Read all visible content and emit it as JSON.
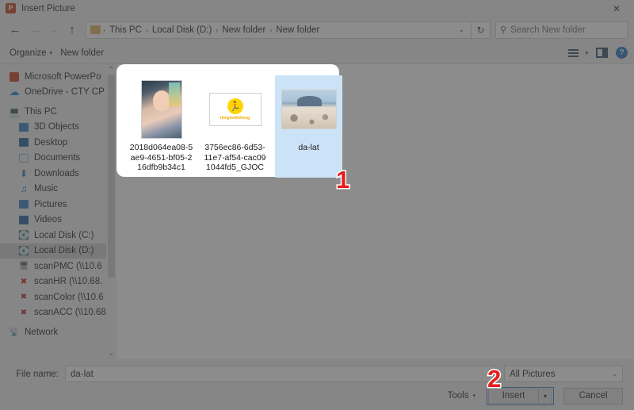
{
  "window": {
    "title": "Insert Picture",
    "app_icon": "powerpoint-icon",
    "close_label": "✕",
    "accent_color": "#c43e1c"
  },
  "nav": {
    "back": "←",
    "forward": "→",
    "recent": "⌄",
    "up": "↑",
    "refresh": "↻",
    "dropdown_caret": "⌄",
    "breadcrumbs": [
      "This PC",
      "Local Disk (D:)",
      "New folder",
      "New folder"
    ],
    "separator": "›"
  },
  "search": {
    "placeholder": "Search New folder",
    "icon": "search-icon"
  },
  "commandbar": {
    "organize": "Organize",
    "new_folder": "New folder",
    "caret": "▾",
    "view_icon": "view-options-icon",
    "pane_icon": "preview-pane-icon",
    "help_icon": "help-icon",
    "help_glyph": "?"
  },
  "sidebar": {
    "items": [
      {
        "label": "Microsoft PowerPo",
        "icon": "powerpoint-icon",
        "level": 0,
        "selected": false
      },
      {
        "label": "OneDrive - CTY CP",
        "icon": "onedrive-icon",
        "level": 0,
        "selected": false
      },
      {
        "label": "This PC",
        "icon": "this-pc-icon",
        "level": 0,
        "selected": false
      },
      {
        "label": "3D Objects",
        "icon": "3d-objects-icon",
        "level": 1,
        "selected": false
      },
      {
        "label": "Desktop",
        "icon": "desktop-icon",
        "level": 1,
        "selected": false
      },
      {
        "label": "Documents",
        "icon": "documents-icon",
        "level": 1,
        "selected": false
      },
      {
        "label": "Downloads",
        "icon": "downloads-icon",
        "level": 1,
        "selected": false
      },
      {
        "label": "Music",
        "icon": "music-icon",
        "level": 1,
        "selected": false
      },
      {
        "label": "Pictures",
        "icon": "pictures-icon",
        "level": 1,
        "selected": false
      },
      {
        "label": "Videos",
        "icon": "videos-icon",
        "level": 1,
        "selected": false
      },
      {
        "label": "Local Disk (C:)",
        "icon": "drive-icon",
        "level": 1,
        "selected": false
      },
      {
        "label": "Local Disk (D:)",
        "icon": "drive-icon",
        "level": 1,
        "selected": true
      },
      {
        "label": "scanPMC (\\\\10.6",
        "icon": "network-drive-icon",
        "level": 1,
        "selected": false
      },
      {
        "label": "scanHR (\\\\10.68.",
        "icon": "network-drive-disconnected-icon",
        "level": 1,
        "selected": false
      },
      {
        "label": "scanColor (\\\\10.6",
        "icon": "network-drive-disconnected-icon",
        "level": 1,
        "selected": false
      },
      {
        "label": "scanACC (\\\\10.68",
        "icon": "network-drive-disconnected-icon",
        "level": 1,
        "selected": false
      },
      {
        "label": "Network",
        "icon": "network-icon",
        "level": 0,
        "selected": false
      }
    ],
    "scroll_up": "⌃",
    "scroll_down": "⌄"
  },
  "files": [
    {
      "name": "2018d064ea08-5ae9-4651-bf05-216dfb9b34c1",
      "thumb": "portrait-photo-thumbnail",
      "selected": false
    },
    {
      "name": "3756ec86-6d53-11e7-af54-cac091044fd5_GJOC",
      "thumb": "yellow-logo-thumbnail",
      "logo_text": "thegioididong",
      "logo_glyph": "☃",
      "selected": false
    },
    {
      "name": "da-lat",
      "thumb": "landscape-photo-thumbnail",
      "selected": true
    }
  ],
  "footer": {
    "file_name_label": "File name:",
    "file_name_value": "da-lat",
    "filter_value": "All Pictures",
    "filter_caret": "⌄",
    "tools_label": "Tools",
    "tools_caret": "▾",
    "insert_label": "Insert",
    "insert_caret": "▾",
    "cancel_label": "Cancel"
  },
  "annotations": [
    {
      "label": "1",
      "target": "file-list-panel"
    },
    {
      "label": "2",
      "target": "insert-button"
    }
  ],
  "colors": {
    "selection_blue": "#cce3f7",
    "focus_border": "#2a72c4",
    "marker_red": "#e81b1b",
    "dialog_chrome": "#f0f0f0"
  }
}
